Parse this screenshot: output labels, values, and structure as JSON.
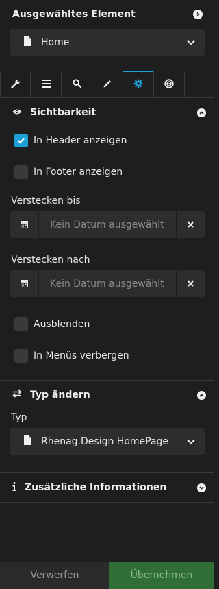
{
  "header": {
    "title": "Ausgewähltes Element"
  },
  "selector": {
    "value": "Home"
  },
  "tabs": [
    {
      "icon": "wrench-icon"
    },
    {
      "icon": "list-icon"
    },
    {
      "icon": "search-icon"
    },
    {
      "icon": "pencil-icon"
    },
    {
      "icon": "gear-icon",
      "active": true
    },
    {
      "icon": "target-icon"
    }
  ],
  "visibility": {
    "title": "Sichtbarkeit",
    "show_in_header": {
      "label": "In Header anzeigen",
      "checked": true
    },
    "show_in_footer": {
      "label": "In Footer anzeigen",
      "checked": false
    },
    "hide_until": {
      "label": "Verstecken bis",
      "placeholder": "Kein Datum ausgewählt"
    },
    "hide_after": {
      "label": "Verstecken nach",
      "placeholder": "Kein Datum ausgewählt"
    },
    "hide": {
      "label": "Ausblenden",
      "checked": false
    },
    "hide_in_menus": {
      "label": "In Menüs verbergen",
      "checked": false
    }
  },
  "change_type": {
    "title": "Typ ändern",
    "field_label": "Typ",
    "value": "Rhenag.Design HomePage"
  },
  "additional_info": {
    "title": "Zusätzliche Informationen"
  },
  "footer": {
    "discard_label": "Verwerfen",
    "apply_label": "Übernehmen"
  },
  "colors": {
    "accent": "#1d9fd8",
    "apply_bg": "#2f6e34",
    "panel_bg": "#1e1e1e"
  }
}
